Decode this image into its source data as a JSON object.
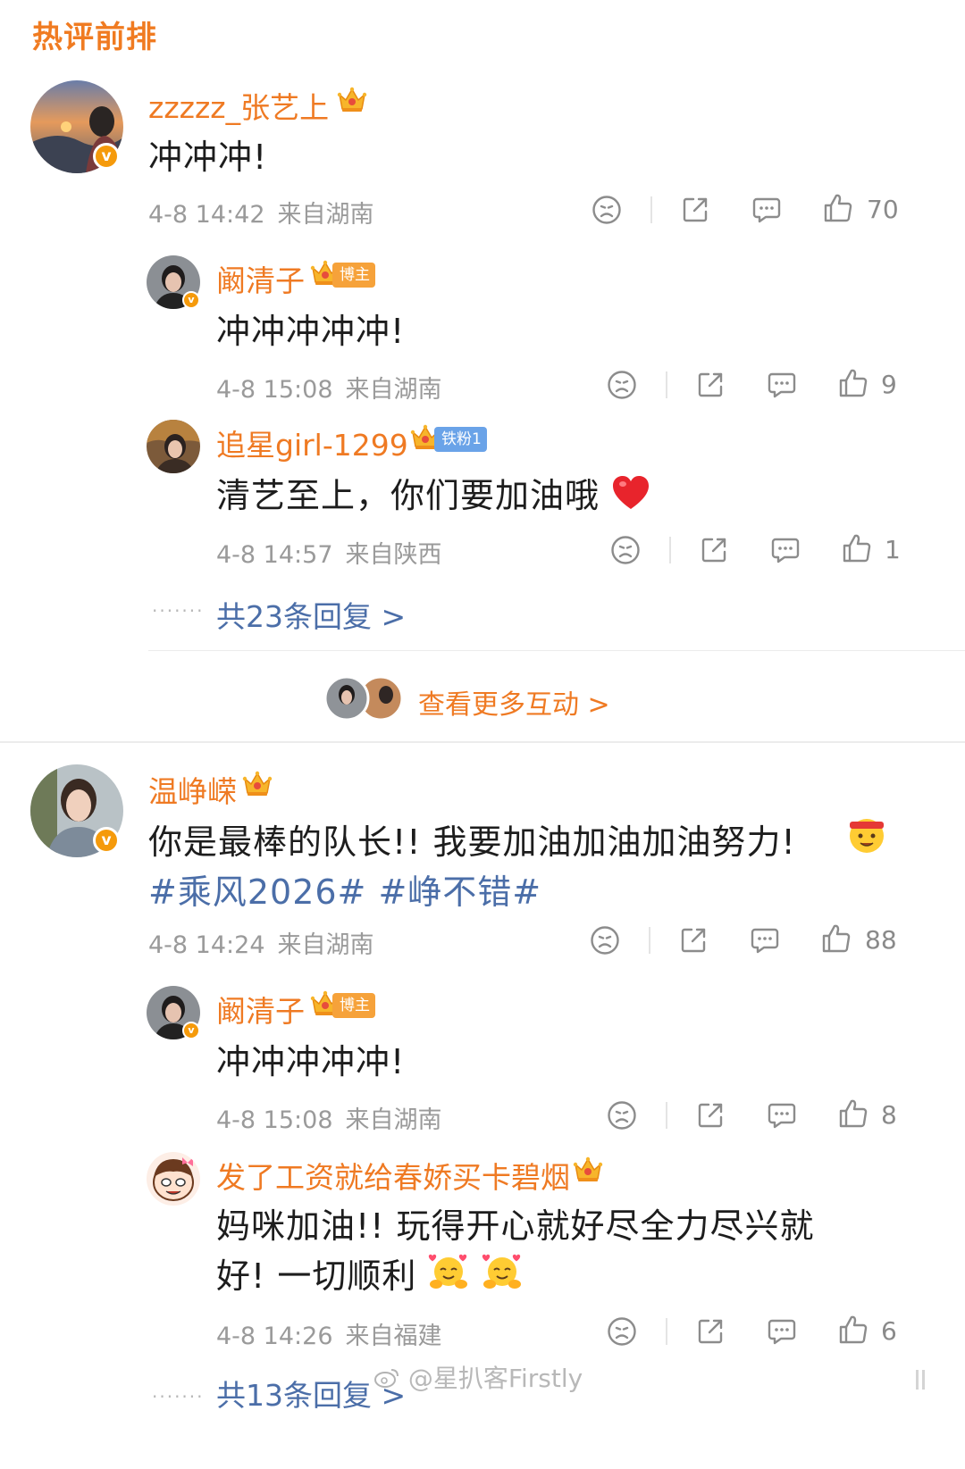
{
  "section_title": "热评前排",
  "comment1": {
    "username": "zzzzz_张艺上",
    "text": "冲冲冲!",
    "time": "4-8 14:42",
    "location": "来自湖南",
    "likes": "70",
    "replies": [
      {
        "username": "阚清子",
        "badge": "博主",
        "text": "冲冲冲冲冲!",
        "time": "4-8 15:08",
        "location": "来自湖南",
        "likes": "9"
      },
      {
        "username": "追星girl-1299",
        "badge": "铁粉1",
        "text": "清艺至上，你们要加油哦",
        "time": "4-8 14:57",
        "location": "来自陕西",
        "likes": "1"
      }
    ],
    "replies_link": "共23条回复 >",
    "more_link": "查看更多互动 >"
  },
  "comment2": {
    "username": "温峥嵘",
    "text": "你是最棒的队长!! 我要加油加油加油努力!",
    "hashtags": "#乘风2026# #峥不错#",
    "time": "4-8 14:24",
    "location": "来自湖南",
    "likes": "88",
    "replies": [
      {
        "username": "阚清子",
        "badge": "博主",
        "text": "冲冲冲冲冲!",
        "time": "4-8 15:08",
        "location": "来自湖南",
        "likes": "8"
      },
      {
        "username": "发了工资就给春娇买卡碧烟",
        "text_line1": "妈咪加油!! 玩得开心就好尽全力尽兴就",
        "text_line2": "好! 一切顺利",
        "time": "4-8 14:26",
        "location": "来自福建",
        "likes": "6"
      }
    ],
    "replies_link": "共13条回复 >"
  },
  "watermark": "@星扒客Firstly",
  "colors": {
    "username": "#ef7a23",
    "link": "#4b6ea8",
    "meta": "#9a9a9a",
    "vip_badge": "#f59a0b"
  },
  "icons": {
    "verified": "v",
    "reactions": [
      "sad-face-icon",
      "share-icon",
      "comment-icon",
      "like-icon"
    ]
  }
}
